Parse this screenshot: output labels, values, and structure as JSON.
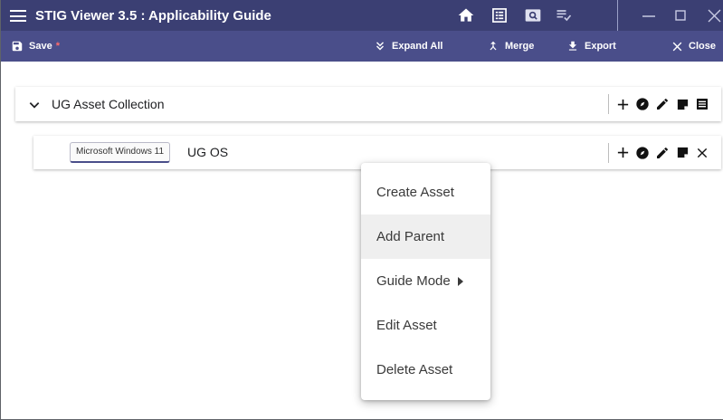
{
  "window": {
    "title": "STIG Viewer 3.5 : Applicability Guide",
    "icons": [
      "home-icon",
      "list-box-icon",
      "search-window-icon",
      "playlist-check-icon"
    ],
    "controls": [
      "minimize-icon",
      "maximize-icon",
      "close-window-icon"
    ]
  },
  "toolbar": {
    "save_label": "Save",
    "save_unsaved_marker": "*",
    "expand_all_label": "Expand All",
    "merge_label": "Merge",
    "export_label": "Export",
    "close_label": "Close"
  },
  "tree": {
    "collection": {
      "label": "UG Asset Collection",
      "actions": [
        "add-icon",
        "compass-icon",
        "edit-icon",
        "note-icon",
        "list-icon"
      ]
    },
    "asset": {
      "chip": "Microsoft Windows 11",
      "label": "UG OS",
      "actions": [
        "add-icon",
        "compass-icon",
        "edit-icon",
        "note-icon",
        "remove-icon"
      ]
    }
  },
  "context_menu": {
    "items": [
      {
        "label": "Create Asset",
        "highlighted": false,
        "submenu": false
      },
      {
        "label": "Add Parent",
        "highlighted": true,
        "submenu": false
      },
      {
        "label": "Guide Mode",
        "highlighted": false,
        "submenu": true
      },
      {
        "label": "Edit Asset",
        "highlighted": false,
        "submenu": false
      },
      {
        "label": "Delete Asset",
        "highlighted": false,
        "submenu": false
      }
    ]
  },
  "colors": {
    "titlebar": "#3b3f73",
    "toolbar": "#4a4e8a",
    "unsaved_star": "#ff6b6b",
    "menu_highlight": "#efefef"
  }
}
